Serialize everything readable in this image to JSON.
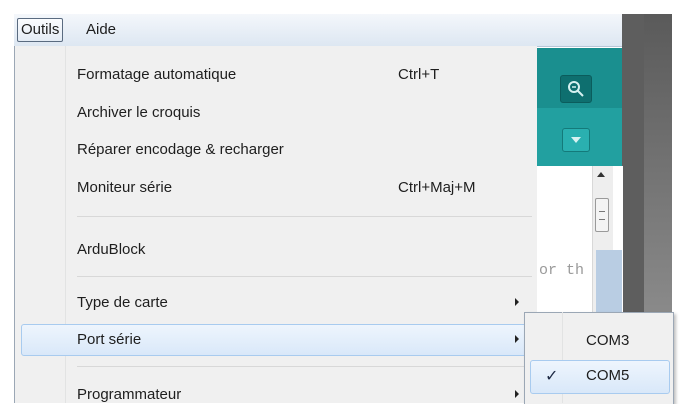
{
  "menubar": {
    "items": [
      {
        "label": "Outils"
      },
      {
        "label": "Aide"
      }
    ]
  },
  "tools_menu": {
    "items": [
      {
        "label": "Formatage automatique",
        "shortcut": "Ctrl+T"
      },
      {
        "label": "Archiver le croquis",
        "shortcut": ""
      },
      {
        "label": "Réparer encodage & recharger",
        "shortcut": ""
      },
      {
        "label": "Moniteur série",
        "shortcut": "Ctrl+Maj+M"
      },
      {
        "label": "ArduBlock",
        "shortcut": ""
      },
      {
        "label": "Type de carte",
        "has_submenu": true
      },
      {
        "label": "Port série",
        "has_submenu": true,
        "highlighted": true
      },
      {
        "label": "Programmateur",
        "has_submenu": true
      }
    ]
  },
  "serial_port_submenu": {
    "items": [
      {
        "label": "COM3",
        "checked": false
      },
      {
        "label": "COM5",
        "checked": true
      }
    ],
    "check_mark": "✓"
  },
  "editor": {
    "visible_text": "or th"
  },
  "icons": {
    "serial_monitor": "magnifier-icon",
    "tab_menu": "chevron-down-icon"
  },
  "colors": {
    "toolbar_teal": "#1a8f8f",
    "highlight": "#d9e8f9",
    "menu_bg": "#f0f0f0"
  }
}
